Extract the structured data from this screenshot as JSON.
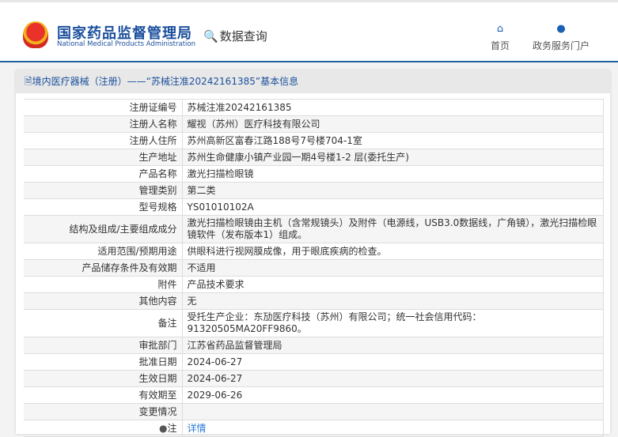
{
  "header": {
    "brand_cn": "国家药品监督管理局",
    "brand_en": "National Medical Products Administration",
    "query_label": "数据查询",
    "nav": [
      {
        "label": "首页",
        "icon": "home-icon"
      },
      {
        "label": "政务服务门户",
        "icon": "user-icon"
      }
    ]
  },
  "card": {
    "title": "境内医疗器械（注册）——“苏械注准20242161385”基本信息"
  },
  "rows": [
    {
      "k": "注册证编号",
      "v": "苏械注准20242161385"
    },
    {
      "k": "注册人名称",
      "v": "耀视（苏州）医疗科技有限公司"
    },
    {
      "k": "注册人住所",
      "v": "苏州高新区富春江路188号7号楼704-1室"
    },
    {
      "k": "生产地址",
      "v": "苏州生命健康小镇产业园一期4号楼1-2 层(委托生产)"
    },
    {
      "k": "产品名称",
      "v": "激光扫描检眼镜"
    },
    {
      "k": "管理类别",
      "v": "第二类"
    },
    {
      "k": "型号规格",
      "v": "YS01010102A"
    },
    {
      "k": "结构及组成/主要组成成分",
      "v": "激光扫描检眼镜由主机（含常规镜头）及附件（电源线，USB3.0数据线，广角镜），激光扫描检眼镜软件（发布版本1）组成。"
    },
    {
      "k": "适用范围/预期用途",
      "v": "供眼科进行视网膜成像，用于眼底疾病的检查。"
    },
    {
      "k": "产品储存条件及有效期",
      "v": "不适用"
    },
    {
      "k": "附件",
      "v": "产品技术要求"
    },
    {
      "k": "其他内容",
      "v": "无"
    },
    {
      "k": "备注",
      "v": "受托生产企业：东劢医疗科技（苏州）有限公司；统一社会信用代码：91320505MA20FF9860。"
    },
    {
      "k": "审批部门",
      "v": "江苏省药品监督管理局"
    },
    {
      "k": "批准日期",
      "v": "2024-06-27"
    },
    {
      "k": "生效日期",
      "v": "2024-06-27"
    },
    {
      "k": "有效期至",
      "v": "2029-06-26"
    },
    {
      "k": "变更情况",
      "v": ""
    }
  ],
  "note": {
    "label": "注",
    "link": "详情"
  }
}
